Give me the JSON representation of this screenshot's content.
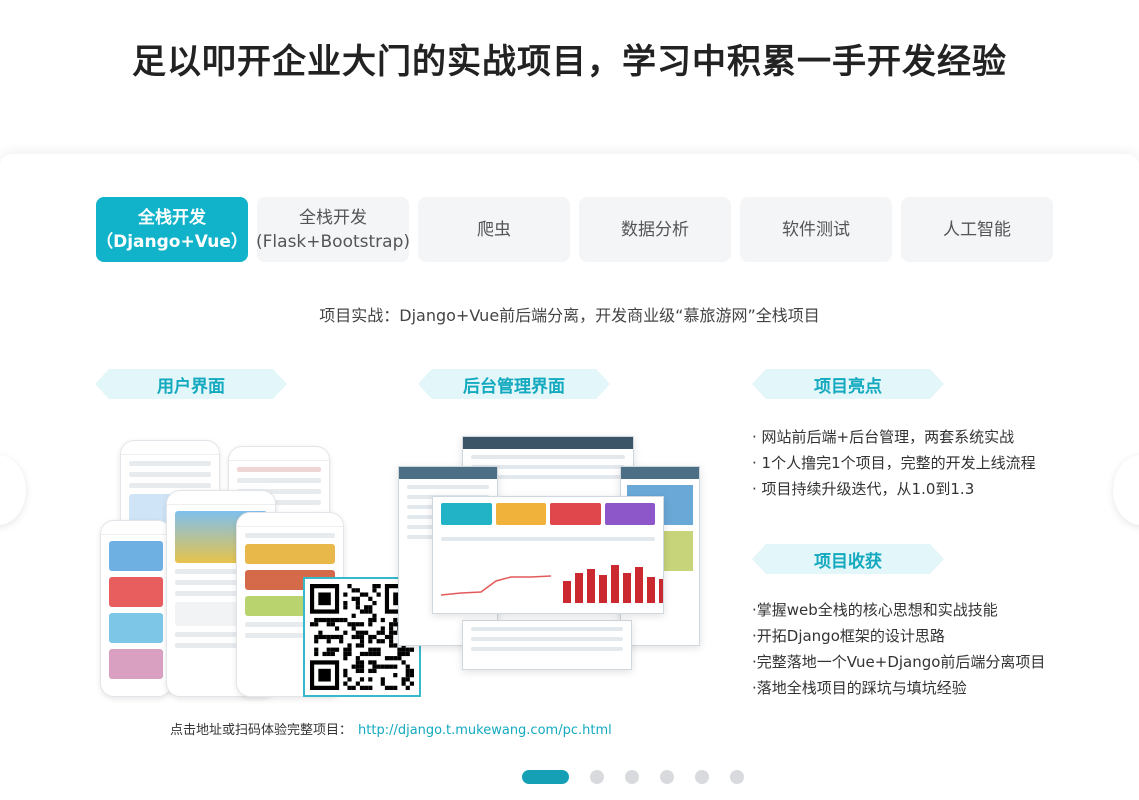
{
  "headline": "足以叩开企业大门的实战项目，学习中积累一手开发经验",
  "tabs": [
    {
      "line1": "全栈开发",
      "line2": "（Django+Vue）"
    },
    {
      "line1": "全栈开发",
      "line2": "(Flask+Bootstrap)"
    },
    {
      "line1": "爬虫",
      "line2": ""
    },
    {
      "line1": "数据分析",
      "line2": ""
    },
    {
      "line1": "软件测试",
      "line2": ""
    },
    {
      "line1": "人工智能",
      "line2": ""
    }
  ],
  "subtitle": "项目实战：Django+Vue前后端分离，开发商业级“慕旅游网”全栈项目",
  "sections": {
    "user_ui": "用户界面",
    "admin_ui": "后台管理界面",
    "highlights_title": "项目亮点",
    "gains_title": "项目收获"
  },
  "highlights": [
    "· 网站前后端+后台管理，两套系统实战",
    "· 1个人撸完1个项目，完整的开发上线流程",
    "· 项目持续升级迭代，从1.0到1.3"
  ],
  "gains": [
    "·掌握web全栈的核心思想和实战技能",
    "·开拓Django框架的设计思路",
    "·完整落地一个Vue+Django前后端分离项目",
    "·落地全栈项目的踩坑与填坑经验"
  ],
  "experience": {
    "label": "点击地址或扫码体验完整项目：",
    "url": "http://django.t.mukewang.com/pc.html"
  },
  "carousel": {
    "count": 6,
    "active": 0
  },
  "colors": {
    "accent": "#10b3c9",
    "ribbon_bg": "#e3f6f9",
    "chart_bar": "#c9292f"
  }
}
